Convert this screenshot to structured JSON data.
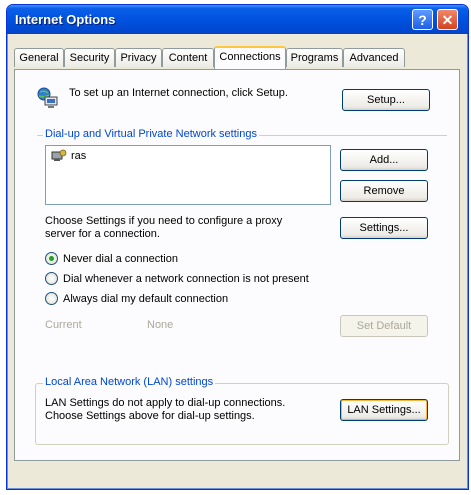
{
  "window": {
    "title": "Internet Options"
  },
  "tabs": [
    {
      "label": "General"
    },
    {
      "label": "Security"
    },
    {
      "label": "Privacy"
    },
    {
      "label": "Content"
    },
    {
      "label": "Connections"
    },
    {
      "label": "Programs"
    },
    {
      "label": "Advanced"
    }
  ],
  "setup": {
    "description": "To set up an Internet connection, click Setup.",
    "button": "Setup..."
  },
  "dialup": {
    "group_label": "Dial-up and Virtual Private Network settings",
    "items": [
      {
        "name": "ras"
      }
    ],
    "add_button": "Add...",
    "remove_button": "Remove",
    "proxy_text": "Choose Settings if you need to configure a proxy server for a connection.",
    "settings_button": "Settings...",
    "options": [
      {
        "label": "Never dial a connection",
        "selected": true
      },
      {
        "label": "Dial whenever a network connection is not present",
        "selected": false
      },
      {
        "label": "Always dial my default connection",
        "selected": false
      }
    ],
    "current_label": "Current",
    "current_value": "None",
    "set_default_button": "Set Default"
  },
  "lan": {
    "group_label": "Local Area Network (LAN) settings",
    "description": "LAN Settings do not apply to dial-up connections. Choose Settings above for dial-up settings.",
    "button": "LAN Settings..."
  },
  "colors": {
    "titlebar": "#0052df",
    "group_label": "#0046d5",
    "selected_radio": "#21a121"
  }
}
